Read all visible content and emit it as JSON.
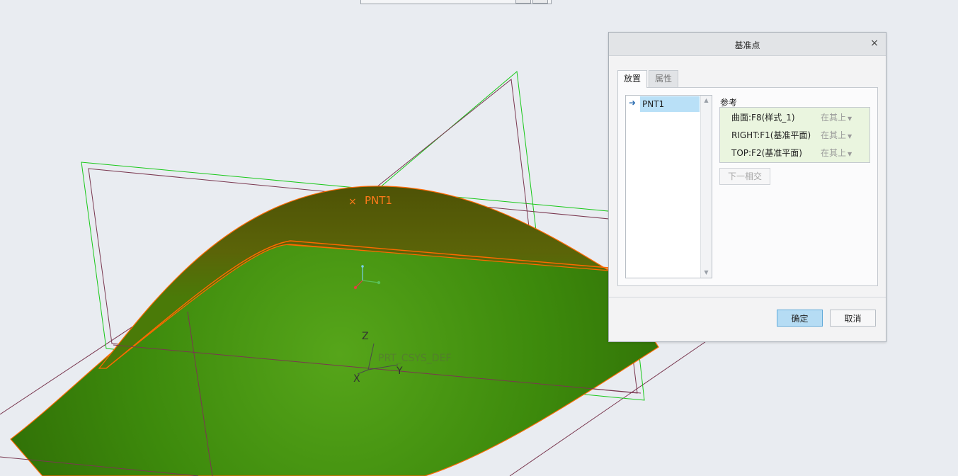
{
  "viewport": {
    "point_label": "PNT1",
    "point_marker": "×",
    "csys_label": "PRT_CSYS_DEF",
    "axis_x": "X",
    "axis_y": "Y",
    "axis_z": "Z"
  },
  "dialog": {
    "title": "基准点",
    "close_glyph": "×",
    "tabs": [
      {
        "label": "放置",
        "active": true
      },
      {
        "label": "属性",
        "active": false
      }
    ],
    "point_list": {
      "items": [
        "PNT1"
      ]
    },
    "references": {
      "label": "参考",
      "rows": [
        {
          "name": "曲面:F8(样式_1)",
          "mode": "在其上"
        },
        {
          "name": "RIGHT:F1(基准平面)",
          "mode": "在其上"
        },
        {
          "name": "TOP:F2(基准平面)",
          "mode": "在其上"
        }
      ]
    },
    "next_intersect_label": "下一相交",
    "ok_label": "确定",
    "cancel_label": "取消"
  },
  "colors": {
    "surface_green": "#3f8a0e",
    "surface_dark": "#5a4a06",
    "edge_orange": "#ff6a00",
    "plane_green": "#19c819",
    "plane_maroon": "#7a3850",
    "annotation_red": "#ee3333",
    "selection_blue": "#b9e0f7",
    "reference_bg": "#eaf5df"
  }
}
